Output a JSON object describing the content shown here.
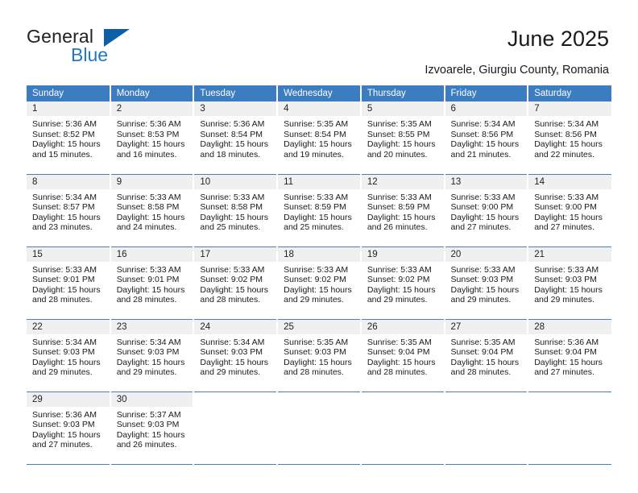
{
  "brand": {
    "name_part1": "General",
    "name_part2": "Blue",
    "blue_hex": "#1f77c4",
    "triangle_hex": "#0e5fa8"
  },
  "header": {
    "title": "June 2025",
    "subtitle": "Izvoarele, Giurgiu County, Romania"
  },
  "theme": {
    "header_bg": "#3c7cc0",
    "daynum_bg": "#f0f0f0",
    "rule": "#4a7fb5"
  },
  "weekdays": [
    "Sunday",
    "Monday",
    "Tuesday",
    "Wednesday",
    "Thursday",
    "Friday",
    "Saturday"
  ],
  "weeks": [
    [
      {
        "day": "1",
        "sunrise": "Sunrise: 5:36 AM",
        "sunset": "Sunset: 8:52 PM",
        "daylight1": "Daylight: 15 hours",
        "daylight2": "and 15 minutes."
      },
      {
        "day": "2",
        "sunrise": "Sunrise: 5:36 AM",
        "sunset": "Sunset: 8:53 PM",
        "daylight1": "Daylight: 15 hours",
        "daylight2": "and 16 minutes."
      },
      {
        "day": "3",
        "sunrise": "Sunrise: 5:36 AM",
        "sunset": "Sunset: 8:54 PM",
        "daylight1": "Daylight: 15 hours",
        "daylight2": "and 18 minutes."
      },
      {
        "day": "4",
        "sunrise": "Sunrise: 5:35 AM",
        "sunset": "Sunset: 8:54 PM",
        "daylight1": "Daylight: 15 hours",
        "daylight2": "and 19 minutes."
      },
      {
        "day": "5",
        "sunrise": "Sunrise: 5:35 AM",
        "sunset": "Sunset: 8:55 PM",
        "daylight1": "Daylight: 15 hours",
        "daylight2": "and 20 minutes."
      },
      {
        "day": "6",
        "sunrise": "Sunrise: 5:34 AM",
        "sunset": "Sunset: 8:56 PM",
        "daylight1": "Daylight: 15 hours",
        "daylight2": "and 21 minutes."
      },
      {
        "day": "7",
        "sunrise": "Sunrise: 5:34 AM",
        "sunset": "Sunset: 8:56 PM",
        "daylight1": "Daylight: 15 hours",
        "daylight2": "and 22 minutes."
      }
    ],
    [
      {
        "day": "8",
        "sunrise": "Sunrise: 5:34 AM",
        "sunset": "Sunset: 8:57 PM",
        "daylight1": "Daylight: 15 hours",
        "daylight2": "and 23 minutes."
      },
      {
        "day": "9",
        "sunrise": "Sunrise: 5:33 AM",
        "sunset": "Sunset: 8:58 PM",
        "daylight1": "Daylight: 15 hours",
        "daylight2": "and 24 minutes."
      },
      {
        "day": "10",
        "sunrise": "Sunrise: 5:33 AM",
        "sunset": "Sunset: 8:58 PM",
        "daylight1": "Daylight: 15 hours",
        "daylight2": "and 25 minutes."
      },
      {
        "day": "11",
        "sunrise": "Sunrise: 5:33 AM",
        "sunset": "Sunset: 8:59 PM",
        "daylight1": "Daylight: 15 hours",
        "daylight2": "and 25 minutes."
      },
      {
        "day": "12",
        "sunrise": "Sunrise: 5:33 AM",
        "sunset": "Sunset: 8:59 PM",
        "daylight1": "Daylight: 15 hours",
        "daylight2": "and 26 minutes."
      },
      {
        "day": "13",
        "sunrise": "Sunrise: 5:33 AM",
        "sunset": "Sunset: 9:00 PM",
        "daylight1": "Daylight: 15 hours",
        "daylight2": "and 27 minutes."
      },
      {
        "day": "14",
        "sunrise": "Sunrise: 5:33 AM",
        "sunset": "Sunset: 9:00 PM",
        "daylight1": "Daylight: 15 hours",
        "daylight2": "and 27 minutes."
      }
    ],
    [
      {
        "day": "15",
        "sunrise": "Sunrise: 5:33 AM",
        "sunset": "Sunset: 9:01 PM",
        "daylight1": "Daylight: 15 hours",
        "daylight2": "and 28 minutes."
      },
      {
        "day": "16",
        "sunrise": "Sunrise: 5:33 AM",
        "sunset": "Sunset: 9:01 PM",
        "daylight1": "Daylight: 15 hours",
        "daylight2": "and 28 minutes."
      },
      {
        "day": "17",
        "sunrise": "Sunrise: 5:33 AM",
        "sunset": "Sunset: 9:02 PM",
        "daylight1": "Daylight: 15 hours",
        "daylight2": "and 28 minutes."
      },
      {
        "day": "18",
        "sunrise": "Sunrise: 5:33 AM",
        "sunset": "Sunset: 9:02 PM",
        "daylight1": "Daylight: 15 hours",
        "daylight2": "and 29 minutes."
      },
      {
        "day": "19",
        "sunrise": "Sunrise: 5:33 AM",
        "sunset": "Sunset: 9:02 PM",
        "daylight1": "Daylight: 15 hours",
        "daylight2": "and 29 minutes."
      },
      {
        "day": "20",
        "sunrise": "Sunrise: 5:33 AM",
        "sunset": "Sunset: 9:03 PM",
        "daylight1": "Daylight: 15 hours",
        "daylight2": "and 29 minutes."
      },
      {
        "day": "21",
        "sunrise": "Sunrise: 5:33 AM",
        "sunset": "Sunset: 9:03 PM",
        "daylight1": "Daylight: 15 hours",
        "daylight2": "and 29 minutes."
      }
    ],
    [
      {
        "day": "22",
        "sunrise": "Sunrise: 5:34 AM",
        "sunset": "Sunset: 9:03 PM",
        "daylight1": "Daylight: 15 hours",
        "daylight2": "and 29 minutes."
      },
      {
        "day": "23",
        "sunrise": "Sunrise: 5:34 AM",
        "sunset": "Sunset: 9:03 PM",
        "daylight1": "Daylight: 15 hours",
        "daylight2": "and 29 minutes."
      },
      {
        "day": "24",
        "sunrise": "Sunrise: 5:34 AM",
        "sunset": "Sunset: 9:03 PM",
        "daylight1": "Daylight: 15 hours",
        "daylight2": "and 29 minutes."
      },
      {
        "day": "25",
        "sunrise": "Sunrise: 5:35 AM",
        "sunset": "Sunset: 9:03 PM",
        "daylight1": "Daylight: 15 hours",
        "daylight2": "and 28 minutes."
      },
      {
        "day": "26",
        "sunrise": "Sunrise: 5:35 AM",
        "sunset": "Sunset: 9:04 PM",
        "daylight1": "Daylight: 15 hours",
        "daylight2": "and 28 minutes."
      },
      {
        "day": "27",
        "sunrise": "Sunrise: 5:35 AM",
        "sunset": "Sunset: 9:04 PM",
        "daylight1": "Daylight: 15 hours",
        "daylight2": "and 28 minutes."
      },
      {
        "day": "28",
        "sunrise": "Sunrise: 5:36 AM",
        "sunset": "Sunset: 9:04 PM",
        "daylight1": "Daylight: 15 hours",
        "daylight2": "and 27 minutes."
      }
    ],
    [
      {
        "day": "29",
        "sunrise": "Sunrise: 5:36 AM",
        "sunset": "Sunset: 9:03 PM",
        "daylight1": "Daylight: 15 hours",
        "daylight2": "and 27 minutes."
      },
      {
        "day": "30",
        "sunrise": "Sunrise: 5:37 AM",
        "sunset": "Sunset: 9:03 PM",
        "daylight1": "Daylight: 15 hours",
        "daylight2": "and 26 minutes."
      },
      {
        "day": "",
        "sunrise": "",
        "sunset": "",
        "daylight1": "",
        "daylight2": ""
      },
      {
        "day": "",
        "sunrise": "",
        "sunset": "",
        "daylight1": "",
        "daylight2": ""
      },
      {
        "day": "",
        "sunrise": "",
        "sunset": "",
        "daylight1": "",
        "daylight2": ""
      },
      {
        "day": "",
        "sunrise": "",
        "sunset": "",
        "daylight1": "",
        "daylight2": ""
      },
      {
        "day": "",
        "sunrise": "",
        "sunset": "",
        "daylight1": "",
        "daylight2": ""
      }
    ]
  ]
}
